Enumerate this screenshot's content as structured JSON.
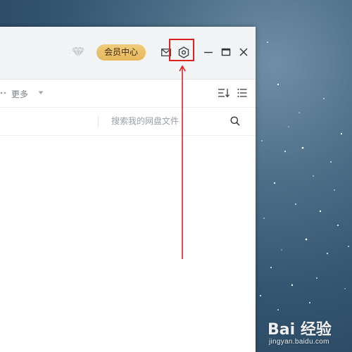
{
  "window": {
    "vip_button_label": "会员中心",
    "toolbar": {
      "more_label": "更多"
    },
    "search": {
      "placeholder": "搜索我的网盘文件"
    }
  },
  "icons": {
    "diamond": "diamond-icon",
    "mail": "mail-icon",
    "settings": "settings-icon",
    "minimize": "minimize-icon",
    "maximize": "maximize-icon",
    "close": "close-icon",
    "sort": "sort-icon",
    "list_view": "list-view-icon",
    "search": "search-icon"
  },
  "annotation": {
    "highlight_color": "#e0201b"
  },
  "watermark": {
    "brand": "Bai 经验",
    "url": "jingyan.baidu.com"
  },
  "colors": {
    "vip_gold": "#e9bd62",
    "titlebar_bg": "#f3f4f6",
    "desktop_blue": "#345672"
  }
}
